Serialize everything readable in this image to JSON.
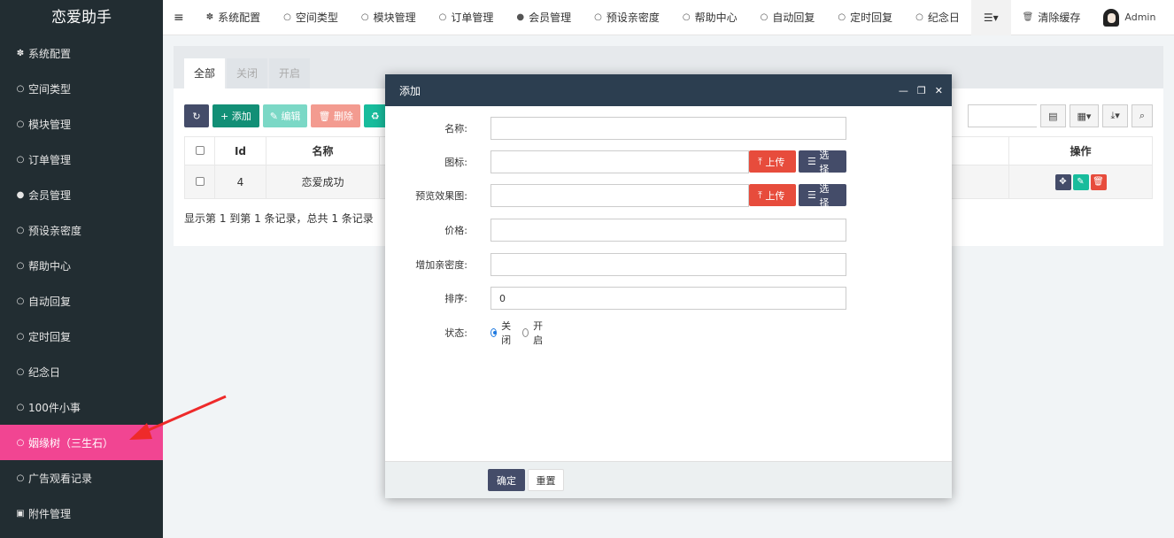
{
  "app": {
    "title": "恋爱助手"
  },
  "sidebar": {
    "items": [
      {
        "label": "系统配置",
        "icon": "gear-icon"
      },
      {
        "label": "空间类型",
        "icon": "circle-icon"
      },
      {
        "label": "模块管理",
        "icon": "circle-icon"
      },
      {
        "label": "订单管理",
        "icon": "circle-icon"
      },
      {
        "label": "会员管理",
        "icon": "user-icon"
      },
      {
        "label": "预设亲密度",
        "icon": "circle-icon"
      },
      {
        "label": "帮助中心",
        "icon": "circle-icon"
      },
      {
        "label": "自动回复",
        "icon": "circle-icon"
      },
      {
        "label": "定时回复",
        "icon": "circle-icon"
      },
      {
        "label": "纪念日",
        "icon": "circle-icon"
      },
      {
        "label": "100件小事",
        "icon": "circle-icon"
      },
      {
        "label": "姻缘树（三生石）",
        "icon": "circle-icon",
        "active": true
      },
      {
        "label": "广告观看记录",
        "icon": "circle-icon"
      },
      {
        "label": "附件管理",
        "icon": "image-icon"
      }
    ],
    "active_color": "#f14592"
  },
  "topnav": {
    "items": [
      {
        "label": "系统配置",
        "icon": "gear-icon"
      },
      {
        "label": "空间类型",
        "icon": "circle-icon"
      },
      {
        "label": "模块管理",
        "icon": "circle-icon"
      },
      {
        "label": "订单管理",
        "icon": "circle-icon"
      },
      {
        "label": "会员管理",
        "icon": "user-icon"
      },
      {
        "label": "预设亲密度",
        "icon": "circle-icon"
      },
      {
        "label": "帮助中心",
        "icon": "circle-icon"
      },
      {
        "label": "自动回复",
        "icon": "circle-icon"
      },
      {
        "label": "定时回复",
        "icon": "circle-icon"
      },
      {
        "label": "纪念日",
        "icon": "circle-icon"
      }
    ],
    "clear_cache": "清除缓存",
    "user": "Admin"
  },
  "panel": {
    "tabs": [
      "全部",
      "关闭",
      "开启"
    ],
    "toolbar": {
      "add": "添加",
      "edit": "编辑",
      "delete": "删除"
    },
    "table": {
      "headers": {
        "id": "Id",
        "name": "名称",
        "ops": "操作"
      },
      "rows": [
        {
          "id": "4",
          "name": "恋爱成功"
        }
      ]
    },
    "footer": "显示第 1 到第 1 条记录，总共 1 条记录"
  },
  "modal": {
    "title": "添加",
    "fields": {
      "name": {
        "label": "名称:",
        "value": ""
      },
      "icon": {
        "label": "图标:",
        "value": ""
      },
      "preview": {
        "label": "预览效果图:",
        "value": ""
      },
      "price": {
        "label": "价格:",
        "value": ""
      },
      "intimacy": {
        "label": "增加亲密度:",
        "value": ""
      },
      "sort": {
        "label": "排序:",
        "value": "0"
      },
      "status": {
        "label": "状态:",
        "options": [
          "关闭",
          "开启"
        ],
        "selected": "关闭"
      }
    },
    "upload_label": "上传",
    "choose_label": "选择",
    "confirm_label": "确定",
    "reset_label": "重置"
  }
}
